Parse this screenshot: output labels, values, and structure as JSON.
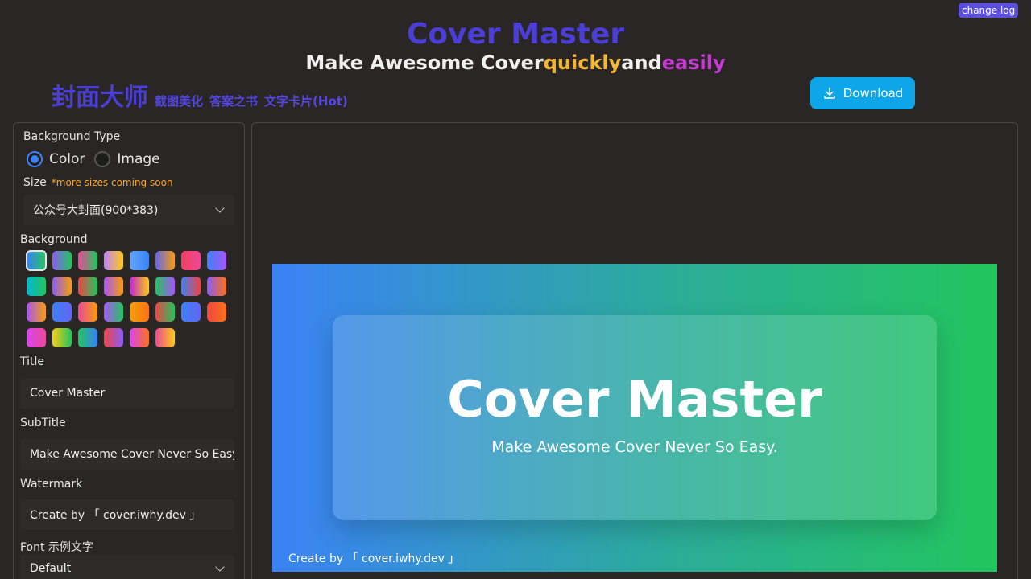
{
  "header": {
    "changelog_label": "change log",
    "app_title": "Cover Master",
    "tagline_prefix": "Make Awesome Cover",
    "tagline_quickly": "quickly",
    "tagline_and": "and",
    "tagline_easily": "easily",
    "brand_cn": "封面大师",
    "nav_links": [
      "截图美化",
      "答案之书",
      "文字卡片(Hot)"
    ],
    "download_label": "Download"
  },
  "colors": {
    "accent": "#4a3ed6",
    "download": "#0ea5e9",
    "quickly": "#f5b731",
    "easily": "#c63cd3"
  },
  "settings": {
    "bg_type_label": "Background Type",
    "bg_type_options": [
      "Color",
      "Image"
    ],
    "bg_type_selected": "Color",
    "size_label": "Size",
    "size_note": "*more sizes coming soon",
    "size_value": "公众号大封面(900*383)",
    "background_label": "Background",
    "swatches": [
      [
        "#3b82f6",
        "#22c55e"
      ],
      [
        "#8b5cf6",
        "#22c55e"
      ],
      [
        "#ec4899",
        "#22c55e"
      ],
      [
        "#c084fc",
        "#facc15"
      ],
      [
        "#60a5fa",
        "#3b82f6"
      ],
      [
        "#6366f1",
        "#f59e0b"
      ],
      [
        "#f43f5e",
        "#ec4899"
      ],
      [
        "#3b82f6",
        "#a855f7"
      ],
      [
        "#06b6d4",
        "#22c55e"
      ],
      [
        "#8b5cf6",
        "#f59e0b"
      ],
      [
        "#ef4444",
        "#22c55e"
      ],
      [
        "#a855f7",
        "#f59e0b"
      ],
      [
        "#c026d3",
        "#facc15"
      ],
      [
        "#22c55e",
        "#a855f7"
      ],
      [
        "#3b82f6",
        "#ef4444"
      ],
      [
        "#8b5cf6",
        "#f97316"
      ],
      [
        "#a855f7",
        "#f59e0b"
      ],
      [
        "#3b82f6",
        "#6366f1"
      ],
      [
        "#ec4899",
        "#f59e0b"
      ],
      [
        "#a855f7",
        "#22c55e"
      ],
      [
        "#f59e0b",
        "#f97316"
      ],
      [
        "#ef4444",
        "#22c55e"
      ],
      [
        "#3b82f6",
        "#6366f1"
      ],
      [
        "#ef4444",
        "#f97316"
      ],
      [
        "#d946ef",
        "#ec4899"
      ],
      [
        "#facc15",
        "#22c55e"
      ],
      [
        "#22c55e",
        "#3b82f6"
      ],
      [
        "#ef4444",
        "#8b5cf6"
      ],
      [
        "#d946ef",
        "#f97316"
      ],
      [
        "#ec4899",
        "#facc15"
      ]
    ],
    "selected_swatch": 0,
    "title_label": "Title",
    "title_value": "Cover Master",
    "subtitle_label": "SubTitle",
    "subtitle_value": "Make Awesome Cover Never So Easy.",
    "watermark_label": "Watermark",
    "watermark_value": "Create by 「 cover.iwhy.dev 」",
    "font_label": "Font 示例文字",
    "font_value": "Default"
  },
  "cover": {
    "title": "Cover Master",
    "subtitle": "Make Awesome Cover Never So Easy.",
    "watermark": "Create by 「 cover.iwhy.dev 」"
  }
}
